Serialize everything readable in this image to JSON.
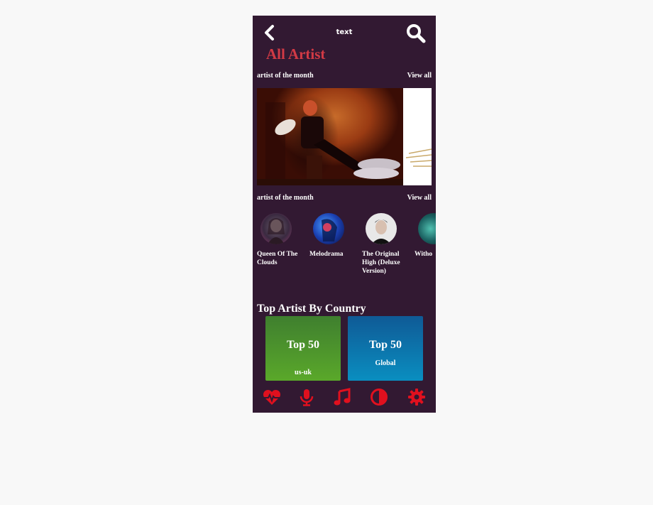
{
  "header": {
    "title": "text",
    "page_title": "All Artist"
  },
  "section1": {
    "label": "artist of the month",
    "view_all": "View all"
  },
  "section2": {
    "label": "artist of the month",
    "view_all": "View all"
  },
  "artists": [
    {
      "name": "Queen Of The Clouds"
    },
    {
      "name": "Melodrama"
    },
    {
      "name": "The Original High (Deluxe Version)"
    },
    {
      "name": "Witho"
    }
  ],
  "country_section": {
    "title": "Top Artist By Country",
    "cards": [
      {
        "title": "Top 50",
        "subtitle": "us-uk"
      },
      {
        "title": "Top 50",
        "subtitle": "Global"
      }
    ]
  },
  "bottom_nav": [
    {
      "icon": "heartbeat-icon"
    },
    {
      "icon": "microphone-icon"
    },
    {
      "icon": "music-icon"
    },
    {
      "icon": "contrast-icon"
    },
    {
      "icon": "gear-icon"
    }
  ],
  "colors": {
    "background": "#321932",
    "accent": "#d23a45",
    "nav_icon": "#e0101e",
    "card_green": "#4e9a2a",
    "card_blue": "#0f6fa8"
  }
}
